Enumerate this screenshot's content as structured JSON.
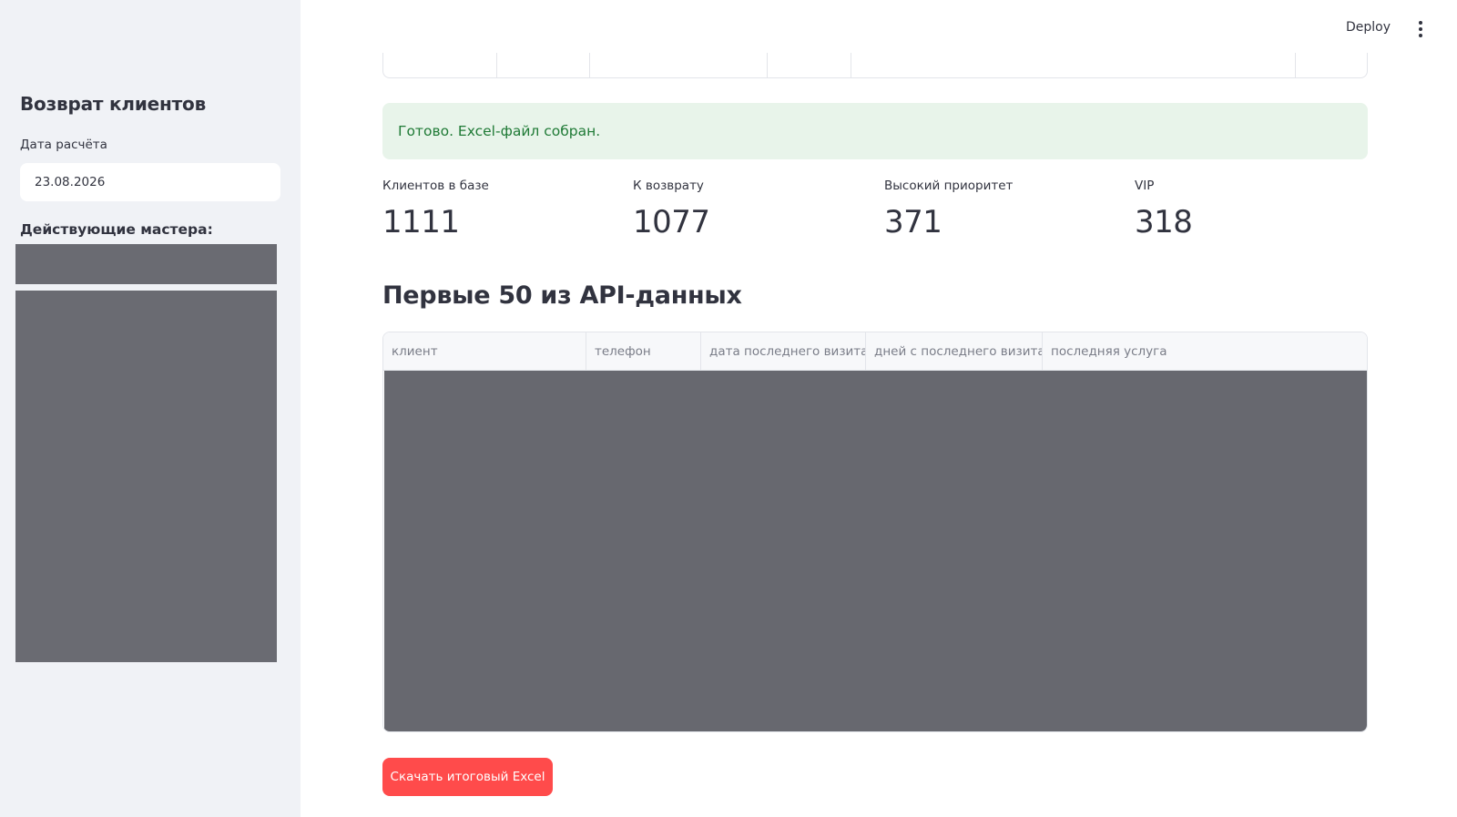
{
  "header": {
    "deploy_label": "Deploy"
  },
  "sidebar": {
    "title": "Возврат клиентов",
    "date_label": "Дата расчёта",
    "date_value": "23.08.2026",
    "masters_label": "Действующие мастера:"
  },
  "alert": {
    "text": "Готово. Excel-файл собран."
  },
  "metrics": [
    {
      "label": "Клиентов в базе",
      "value": "1111"
    },
    {
      "label": "К возврату",
      "value": "1077"
    },
    {
      "label": "Высокий приоритет",
      "value": "371"
    },
    {
      "label": "VIP",
      "value": "318"
    }
  ],
  "table": {
    "heading": "Первые 50 из API-данных",
    "columns": [
      "клиент",
      "телефон",
      "дата последнего визита",
      "дней с последнего визита",
      "последняя услуга"
    ]
  },
  "download_label": "Скачать итоговый Excel",
  "icons": {
    "menu": "vertical-dots-icon"
  }
}
